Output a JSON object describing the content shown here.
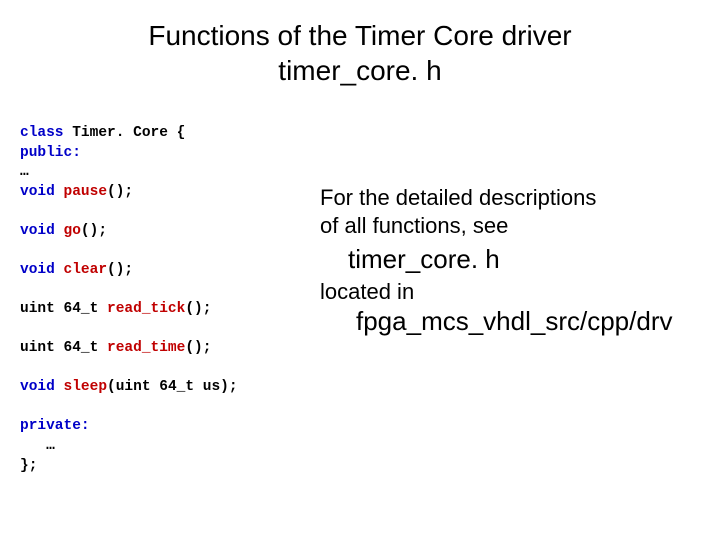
{
  "title": {
    "line1": "Functions of the Timer Core driver",
    "line2": "timer_core. h"
  },
  "code": {
    "l1_kw": "class ",
    "l1_name": "Timer. Core ",
    "l1_brace": "{",
    "l2": "public:",
    "l3": "…",
    "l4_kw": "void ",
    "l4_fn": "pause",
    "l4_end": "();",
    "l5_kw": "void ",
    "l5_fn": "go",
    "l5_end": "();",
    "l6_kw": "void ",
    "l6_fn": "clear",
    "l6_end": "();",
    "l7_t": "uint 64_t ",
    "l7_fn": "read_tick",
    "l7_end": "();",
    "l8_t": "uint 64_t ",
    "l8_fn": "read_time",
    "l8_end": "();",
    "l9_kw": "void ",
    "l9_fn": "sleep",
    "l9_open": "(",
    "l9_argt": "uint 64_t ",
    "l9_arg": "us",
    "l9_end": ");",
    "l10": "private:",
    "l11": "   …",
    "l12": "};"
  },
  "right": {
    "desc1a": "For the detailed descriptions",
    "desc1b": "of all functions, see",
    "desc2": "timer_core. h",
    "desc3": "located in",
    "desc4": "fpga_mcs_vhdl_src/cpp/drv"
  }
}
